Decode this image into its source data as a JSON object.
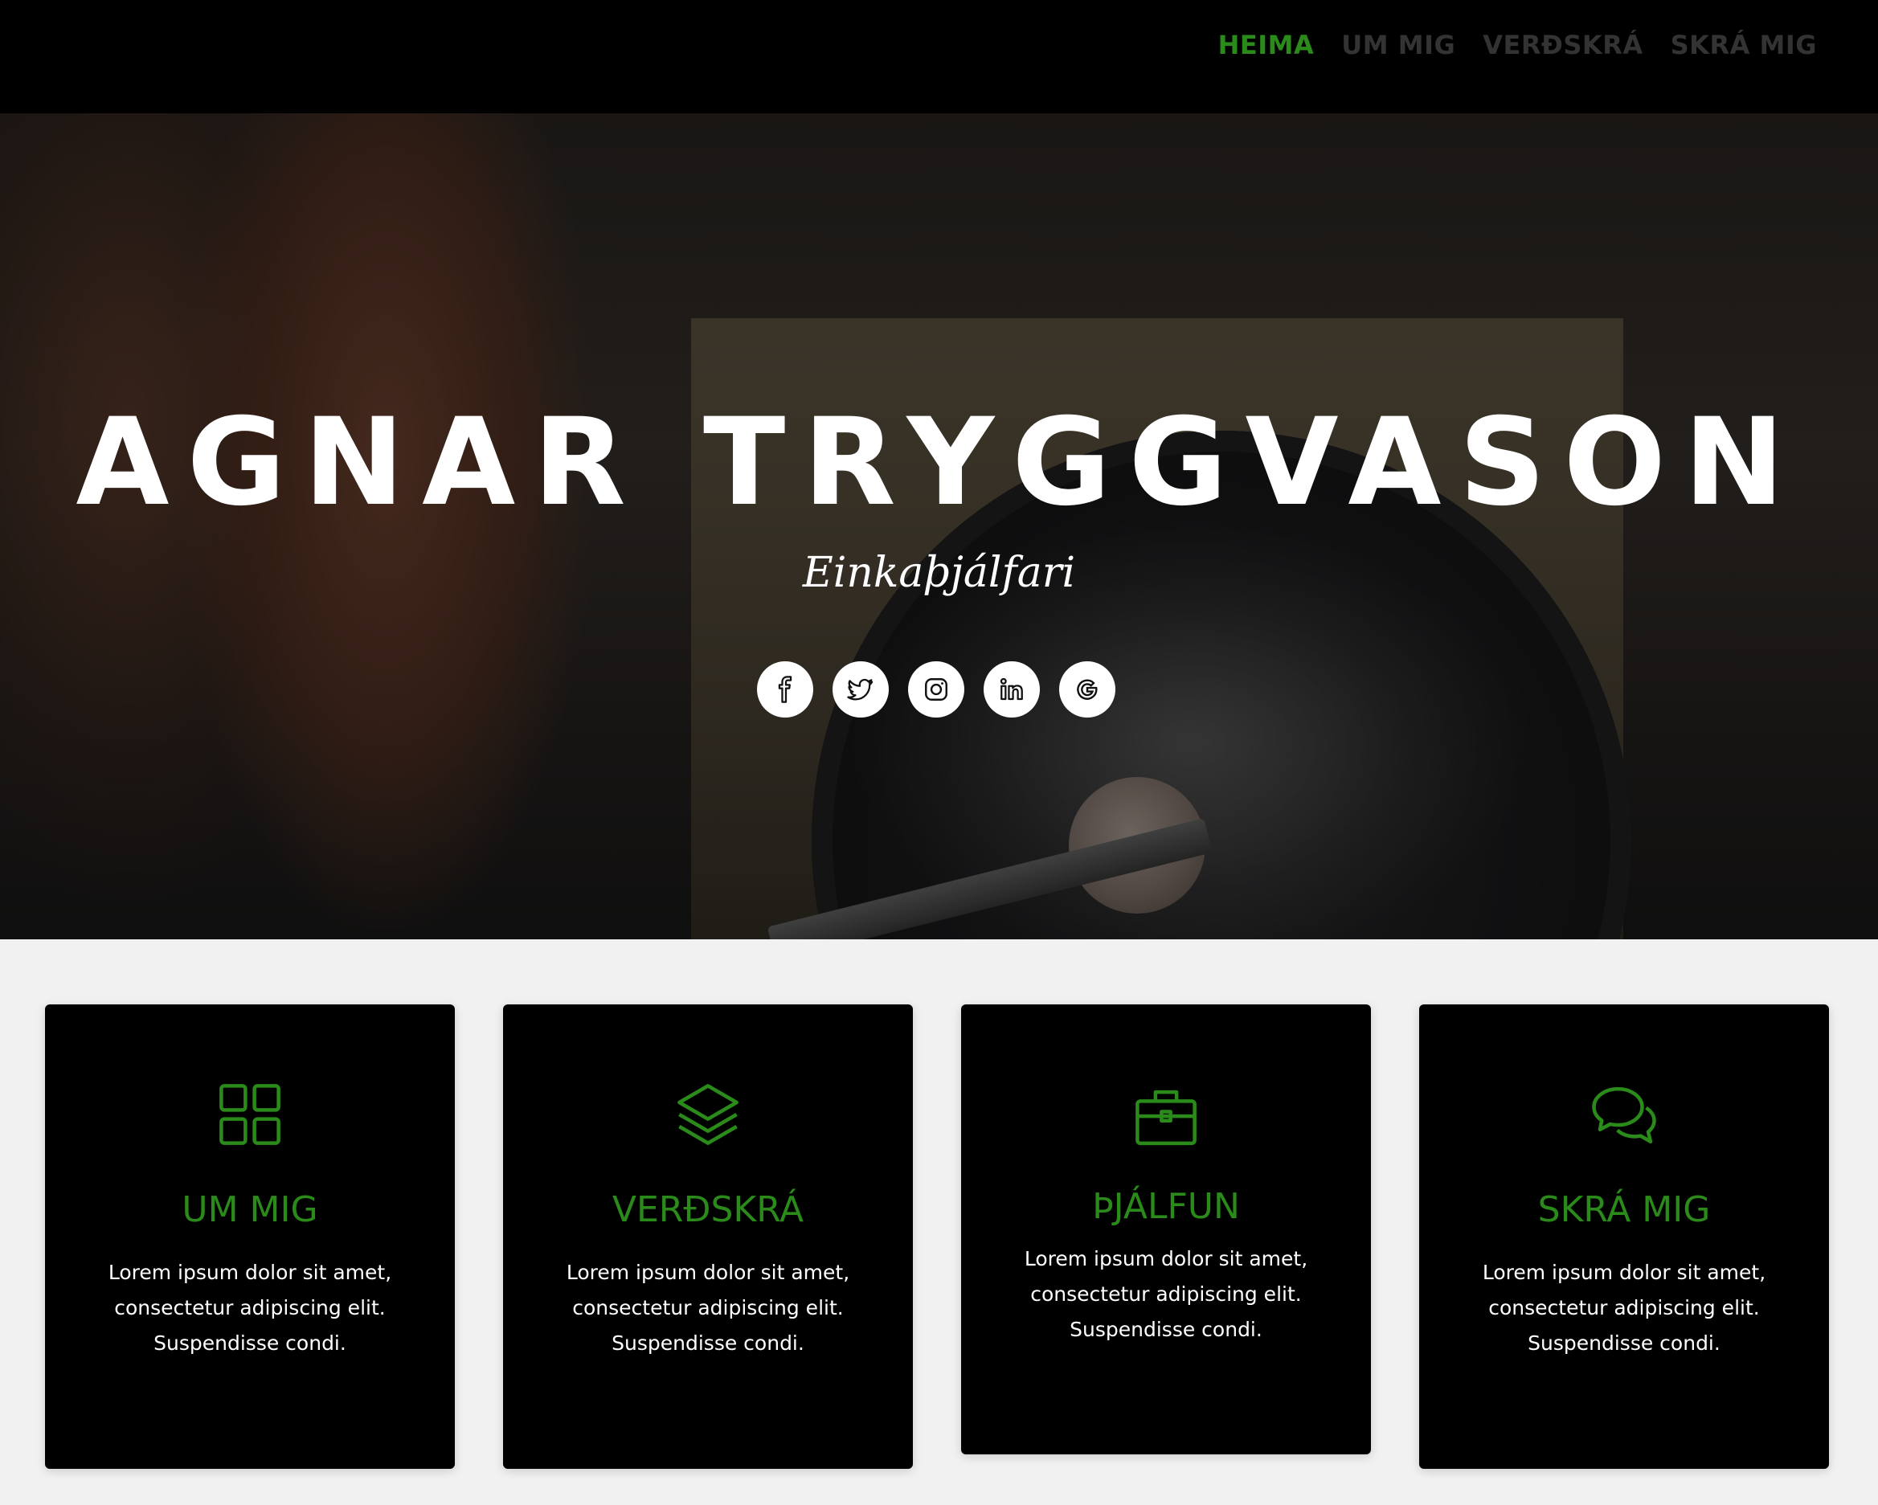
{
  "nav": {
    "items": [
      {
        "label": "HEIMA",
        "active": true
      },
      {
        "label": "UM MIG",
        "active": false
      },
      {
        "label": "VERÐSKRÁ",
        "active": false
      },
      {
        "label": "SKRÁ MIG",
        "active": false
      }
    ]
  },
  "hero": {
    "title": "AGNAR TRYGGVASON",
    "subtitle": "Einkaþjálfari",
    "social": [
      "facebook-icon",
      "twitter-icon",
      "instagram-icon",
      "linkedin-icon",
      "google-icon"
    ]
  },
  "cards": [
    {
      "title": "UM MIG",
      "icon": "grid-icon",
      "text": "Lorem ipsum dolor sit amet, consectetur adipiscing elit. Suspendisse condi."
    },
    {
      "title": "VERÐSKRÁ",
      "icon": "layers-icon",
      "text": "Lorem ipsum dolor sit amet, consectetur adipiscing elit. Suspendisse condi."
    },
    {
      "title": "ÞJÁLFUN",
      "icon": "briefcase-icon",
      "text": "Lorem ipsum dolor sit amet, consectetur adipiscing elit. Suspendisse condi."
    },
    {
      "title": "SKRÁ MIG",
      "icon": "chat-bubbles-icon",
      "text": "Lorem ipsum dolor sit amet, consectetur adipiscing elit. Suspendisse condi."
    }
  ],
  "colors": {
    "accent": "#2a8a1a",
    "nav_bg": "#000000",
    "nav_inactive": "#333333",
    "card_bg": "#000000",
    "page_bg": "#f1f1f1"
  }
}
